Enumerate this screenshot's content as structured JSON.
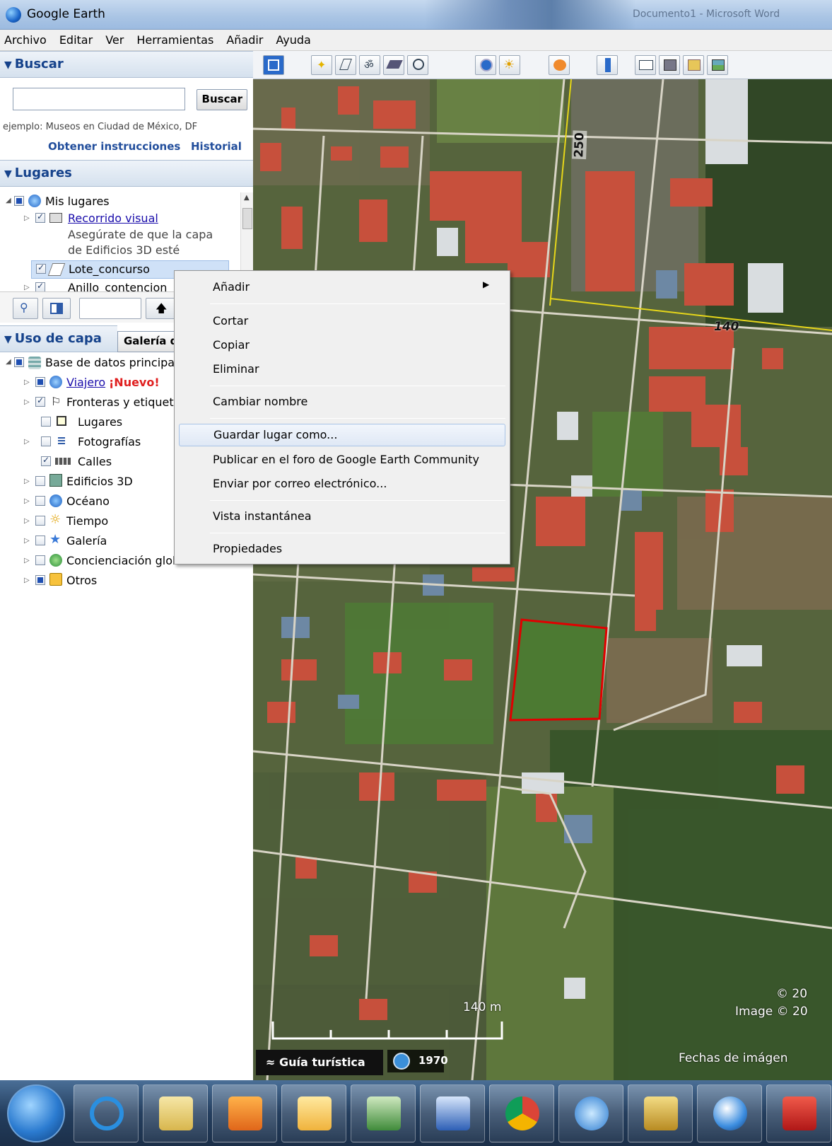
{
  "window": {
    "title": "Google Earth",
    "background_doc": "Documento1 - Microsoft Word"
  },
  "menubar": [
    "Archivo",
    "Editar",
    "Ver",
    "Herramientas",
    "Añadir",
    "Ayuda"
  ],
  "search": {
    "header": "Buscar",
    "placeholder": "",
    "button": "Buscar",
    "example": "ejemplo: Museos en Ciudad de México, DF",
    "get_directions": "Obtener instrucciones",
    "history": "Historial"
  },
  "places": {
    "header": "Lugares",
    "items": [
      {
        "label": "Mis lugares"
      },
      {
        "label": "Recorrido visual",
        "desc1": "Asegúrate de que la capa",
        "desc2": "de Edificios 3D esté"
      },
      {
        "label": "Lote_concurso"
      },
      {
        "label": "Anillo_contencion"
      }
    ]
  },
  "layers": {
    "header": "Uso de capa",
    "tab": "Galería de",
    "items": [
      {
        "label": "Base de datos principal"
      },
      {
        "label": "Viajero",
        "badge": "¡Nuevo!"
      },
      {
        "label": "Fronteras y etiquetas"
      },
      {
        "label": "Lugares"
      },
      {
        "label": "Fotografías"
      },
      {
        "label": "Calles"
      },
      {
        "label": "Edificios 3D"
      },
      {
        "label": "Océano"
      },
      {
        "label": "Tiempo"
      },
      {
        "label": "Galería"
      },
      {
        "label": "Concienciación global"
      },
      {
        "label": "Otros"
      }
    ]
  },
  "context_menu": {
    "items": [
      "Añadir",
      "Cortar",
      "Copiar",
      "Eliminar",
      "Cambiar nombre",
      "Guardar lugar como...",
      "Publicar en el foro de Google Earth Community",
      "Enviar por correo electrónico...",
      "Vista instantánea",
      "Propiedades"
    ],
    "selected": "Guardar lugar como..."
  },
  "map": {
    "road_labels": [
      "250",
      "140"
    ],
    "scale_label": "140 m",
    "copyright1": "© 20",
    "copyright2": "Image © 20",
    "tour_guide": "Guía turística",
    "year": "1970",
    "imagery_dates": "Fechas de imágen"
  },
  "colors": {
    "panel_header": "#15428b",
    "link": "#1a0dab",
    "new_badge": "#e02020",
    "polygon": "#e00000",
    "menu_highlight": "#dfe8f5"
  },
  "taskbar": {
    "apps": [
      "start-icon",
      "internet-explorer-icon",
      "file-explorer-icon",
      "media-player-icon",
      "outlook-icon",
      "excel-icon",
      "word-icon",
      "chrome-icon",
      "search-app-icon",
      "archive-icon",
      "google-earth-icon",
      "acrobat-icon"
    ]
  }
}
